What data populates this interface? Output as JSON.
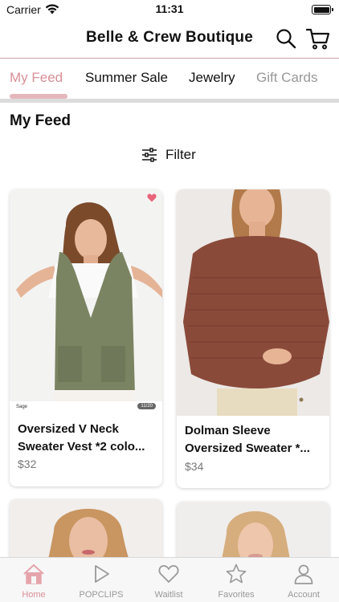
{
  "status_bar": {
    "carrier": "Carrier",
    "time": "11:31"
  },
  "header": {
    "title": "Belle & Crew Boutique",
    "icons": [
      "search-icon",
      "cart-icon"
    ]
  },
  "tabs": [
    {
      "label": "My Feed",
      "active": true
    },
    {
      "label": "Summer Sale",
      "active": false
    },
    {
      "label": "Jewelry",
      "active": false
    },
    {
      "label": "Gift Cards",
      "active": false
    }
  ],
  "page": {
    "title": "My Feed",
    "filter_label": "Filter"
  },
  "products": [
    {
      "name": "Oversized V Neck Sweater Vest *2 colo...",
      "price": "$32",
      "favorited": true,
      "image_tag": "Sage",
      "image_count": "11/20"
    },
    {
      "name": "Dolman Sleeve Oversized Sweater *...",
      "price": "$34",
      "favorited": false
    }
  ],
  "tabbar": [
    {
      "label": "Home",
      "icon": "home-icon",
      "active": true
    },
    {
      "label": "POPCLIPS",
      "icon": "play-icon",
      "active": false
    },
    {
      "label": "Waitlist",
      "icon": "heart-icon",
      "active": false
    },
    {
      "label": "Favorites",
      "icon": "star-icon",
      "active": false
    },
    {
      "label": "Account",
      "icon": "person-icon",
      "active": false
    }
  ],
  "colors": {
    "accent": "#d98f98",
    "indicator": "#e5b7bc",
    "divider": "#c9a7a7"
  }
}
